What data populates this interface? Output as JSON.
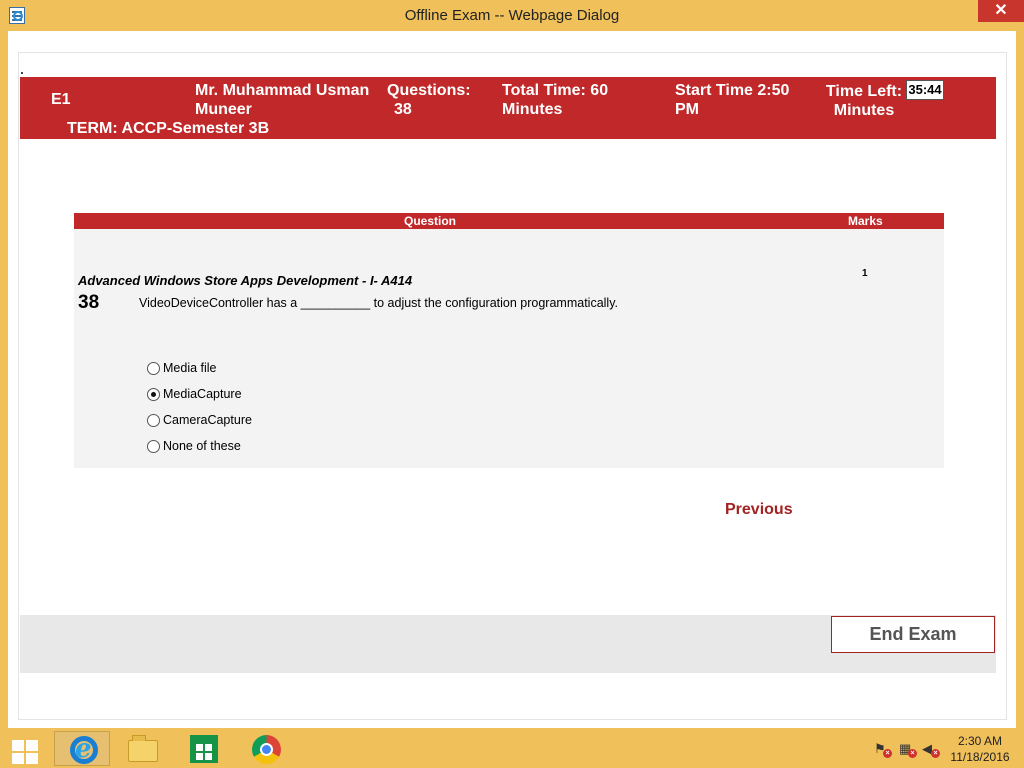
{
  "window": {
    "title": "Offline Exam -- Webpage Dialog",
    "close_glyph": "✕"
  },
  "header": {
    "code": "E1",
    "candidate_line1": "Mr. Muhammad Usman",
    "candidate_line2": "Muneer",
    "questions_label": "Questions:",
    "questions_value": "38",
    "total_time_line1": "Total Time:  60",
    "total_time_line2": "Minutes",
    "start_time_line1": "Start Time  2:50",
    "start_time_line2": "PM",
    "time_left_line1": "Time Left:",
    "time_left_line2": "Minutes",
    "time_left_value": "35:44",
    "term": "TERM: ACCP-Semester 3B"
  },
  "question_table": {
    "col_question": "Question",
    "col_marks": "Marks",
    "subject": "Advanced Windows Store Apps Development - I- A414",
    "number": "38",
    "text": "VideoDeviceController has a __________ to adjust the configuration programmatically.",
    "marks": "1",
    "options": [
      {
        "label": "Media file",
        "selected": false
      },
      {
        "label": "MediaCapture",
        "selected": true
      },
      {
        "label": "CameraCapture",
        "selected": false
      },
      {
        "label": "None of these",
        "selected": false
      }
    ]
  },
  "nav": {
    "previous_label": "Previous",
    "end_exam_label": "End Exam"
  },
  "taskbar": {
    "items": [
      "start-icon",
      "internet-explorer-icon",
      "file-explorer-icon",
      "store-icon",
      "chrome-icon"
    ],
    "time": "2:30 AM",
    "date": "11/18/2016"
  },
  "colors": {
    "header_red": "#c0282a",
    "accent_dark_red": "#a32222",
    "taskbar_gold": "#f0c05a"
  }
}
